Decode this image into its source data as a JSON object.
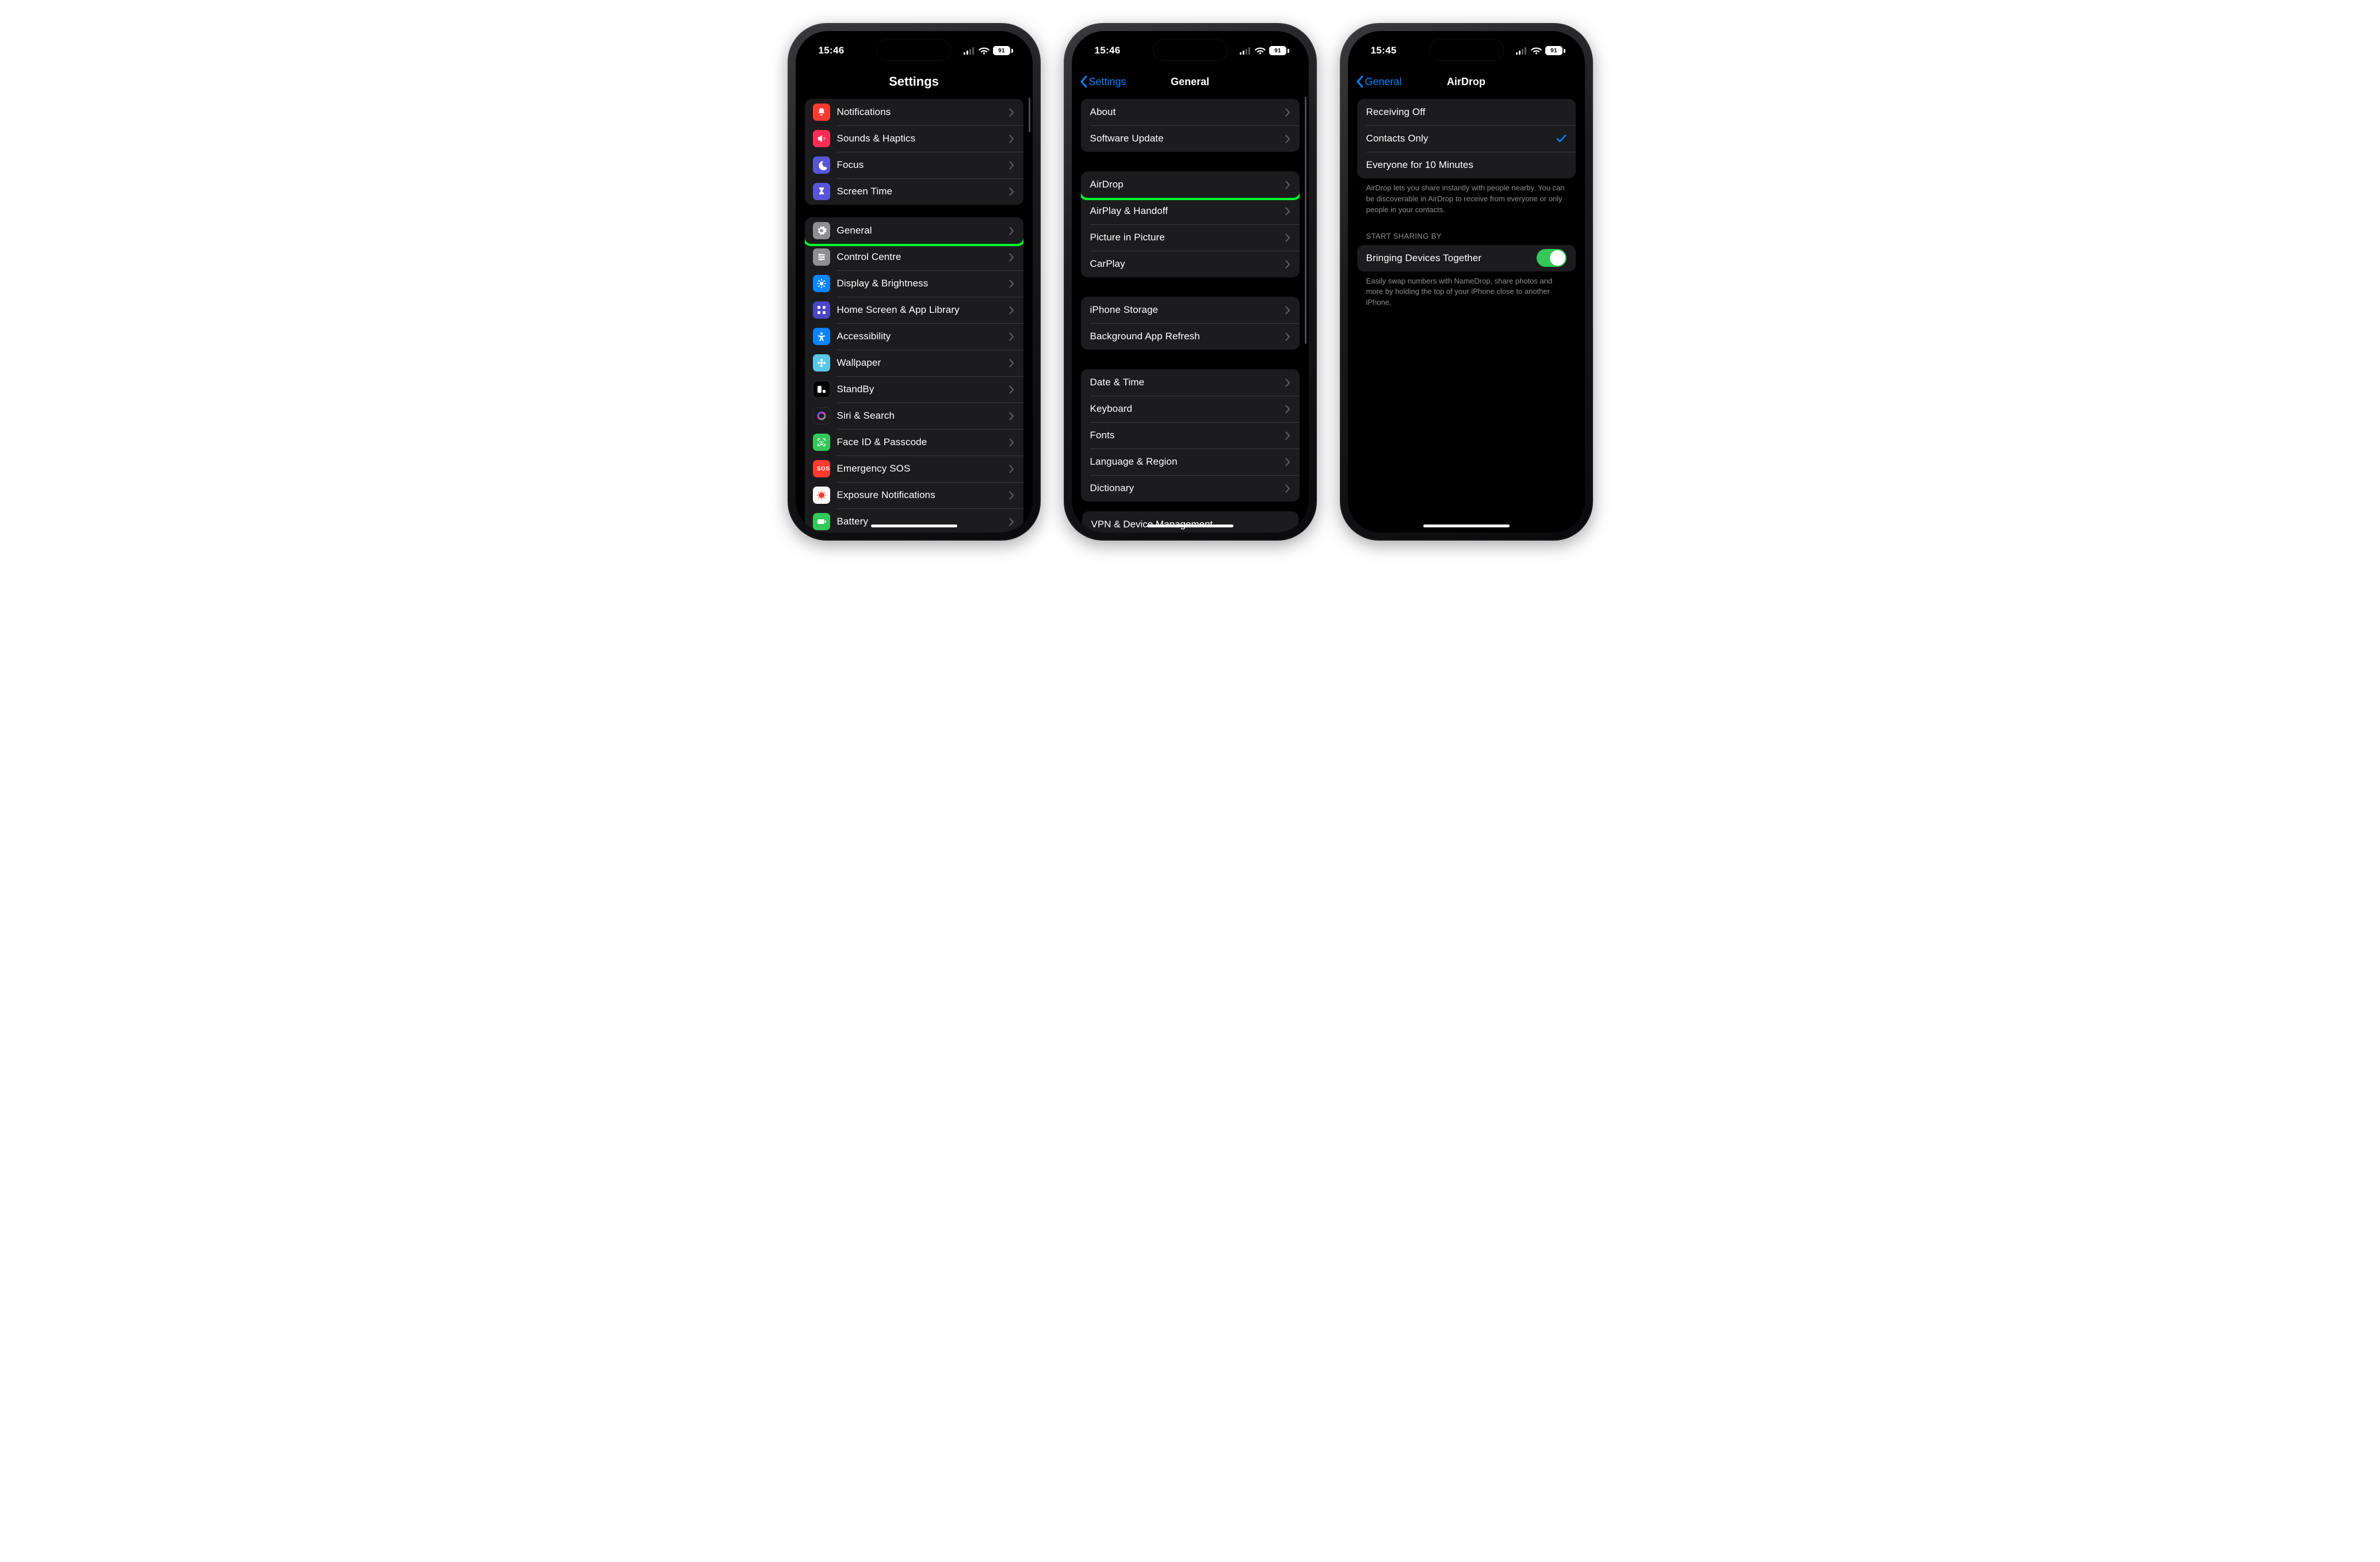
{
  "status": {
    "time1": "15:46",
    "time2": "15:46",
    "time3": "15:45",
    "battery": "91"
  },
  "s1": {
    "title": "Settings",
    "groups": [
      [
        {
          "icon": "bell",
          "bg": "#ff3b30",
          "label": "Notifications"
        },
        {
          "icon": "speaker",
          "bg": "#ff2d55",
          "label": "Sounds & Haptics"
        },
        {
          "icon": "moon",
          "bg": "#5856d6",
          "label": "Focus"
        },
        {
          "icon": "hourglass",
          "bg": "#5856d6",
          "label": "Screen Time"
        }
      ],
      [
        {
          "icon": "gear",
          "bg": "#8e8e93",
          "label": "General",
          "highlight": true
        },
        {
          "icon": "sliders",
          "bg": "#8e8e93",
          "label": "Control Centre"
        },
        {
          "icon": "sun",
          "bg": "#0a84ff",
          "label": "Display & Brightness"
        },
        {
          "icon": "grid",
          "bg": "#4b46c8",
          "label": "Home Screen & App Library"
        },
        {
          "icon": "access",
          "bg": "#0a84ff",
          "label": "Accessibility"
        },
        {
          "icon": "flower",
          "bg": "#59c8e6",
          "label": "Wallpaper"
        },
        {
          "icon": "standby",
          "bg": "#000",
          "label": "StandBy"
        },
        {
          "icon": "siri",
          "bg": "#1c1c1e",
          "label": "Siri & Search"
        },
        {
          "icon": "faceid",
          "bg": "#34c759",
          "label": "Face ID & Passcode"
        },
        {
          "icon": "sos",
          "bg": "#ff3b30",
          "label": "Emergency SOS"
        },
        {
          "icon": "exposure",
          "bg": "#fff",
          "label": "Exposure Notifications"
        },
        {
          "icon": "battery",
          "bg": "#34c759",
          "label": "Battery"
        }
      ]
    ]
  },
  "s2": {
    "back": "Settings",
    "title": "General",
    "groups": [
      [
        "About",
        "Software Update"
      ],
      [
        "AirDrop",
        "AirPlay & Handoff",
        "Picture in Picture",
        "CarPlay"
      ],
      [
        "iPhone Storage",
        "Background App Refresh"
      ],
      [
        "Date & Time",
        "Keyboard",
        "Fonts",
        "Language & Region",
        "Dictionary"
      ]
    ],
    "highlight": "AirDrop",
    "cut": "VPN & Device Management"
  },
  "s3": {
    "back": "General",
    "title": "AirDrop",
    "options": [
      "Receiving Off",
      "Contacts Only",
      "Everyone for 10 Minutes"
    ],
    "selected": "Contacts Only",
    "note1": "AirDrop lets you share instantly with people nearby. You can be discoverable in AirDrop to receive from everyone or only people in your contacts.",
    "section_header": "START SHARING BY",
    "toggle_label": "Bringing Devices Together",
    "toggle_on": true,
    "toggle_highlight": true,
    "note2": "Easily swap numbers with NameDrop, share photos and more by holding the top of your iPhone close to another iPhone."
  }
}
